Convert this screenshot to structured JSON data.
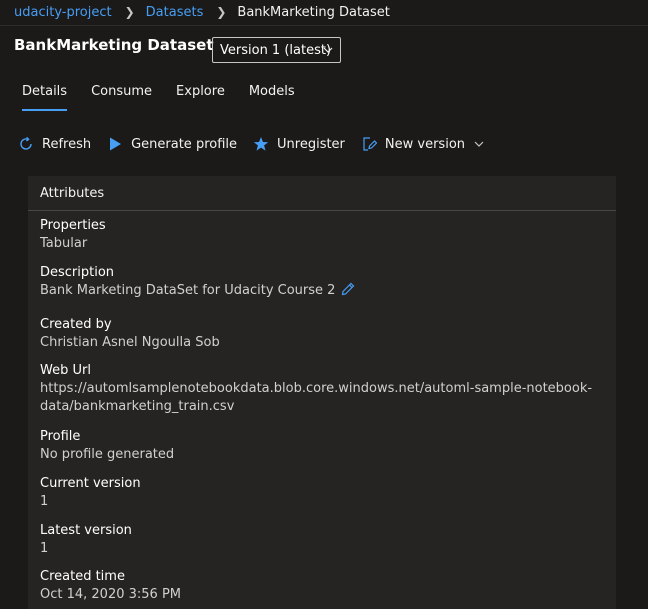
{
  "breadcrumb": {
    "items": [
      "udacity-project",
      "Datasets"
    ],
    "current": "BankMarketing Dataset"
  },
  "header": {
    "title": "BankMarketing Dataset",
    "version_select": "Version 1 (latest)"
  },
  "tabs": [
    {
      "label": "Details",
      "active": true
    },
    {
      "label": "Consume",
      "active": false
    },
    {
      "label": "Explore",
      "active": false
    },
    {
      "label": "Models",
      "active": false
    }
  ],
  "toolbar": {
    "refresh": "Refresh",
    "generate_profile": "Generate profile",
    "unregister": "Unregister",
    "new_version": "New version"
  },
  "attributes": {
    "heading": "Attributes",
    "properties": {
      "label": "Properties",
      "value": "Tabular"
    },
    "description": {
      "label": "Description",
      "value": "Bank Marketing DataSet for Udacity Course 2"
    },
    "created_by": {
      "label": "Created by",
      "value": "Christian Asnel Ngoulla Sob"
    },
    "web_url": {
      "label": "Web Url",
      "value_line1": "https://automlsamplenotebookdata.blob.core.windows.net/automl-sample-notebook-",
      "value_line2": "data/bankmarketing_train.csv"
    },
    "profile": {
      "label": "Profile",
      "value": "No profile generated"
    },
    "current_version": {
      "label": "Current version",
      "value": "1"
    },
    "latest_version": {
      "label": "Latest version",
      "value": "1"
    },
    "created_time": {
      "label": "Created time",
      "value": "Oct 14, 2020 3:56 PM"
    }
  },
  "colors": {
    "accent": "#479ef5",
    "background": "#1b1a19",
    "panel": "#252423"
  }
}
